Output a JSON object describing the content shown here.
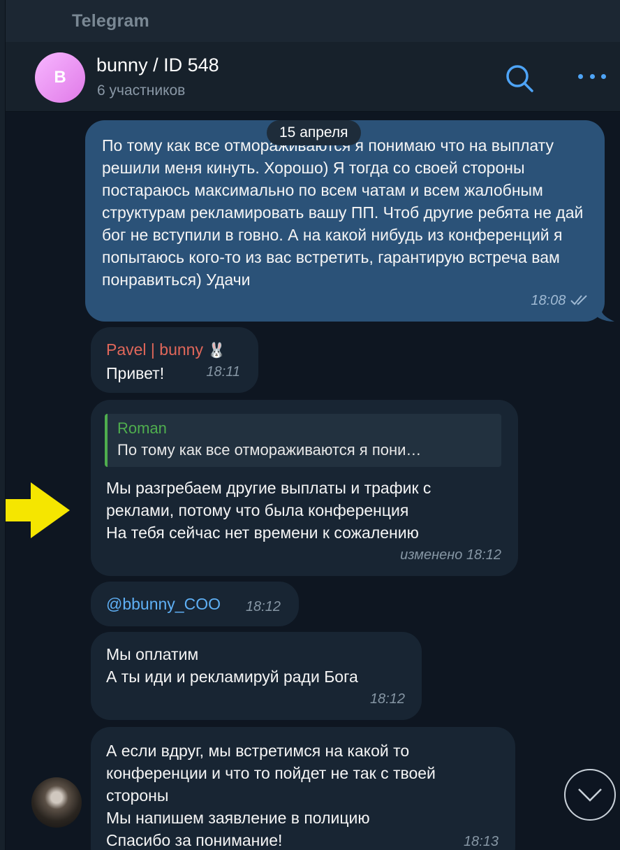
{
  "app": {
    "title": "Telegram"
  },
  "chat": {
    "avatar_letter": "B",
    "name": "bunny / ID 548",
    "subtitle": "6 участников"
  },
  "date_separator": "15 апреля",
  "messages": [
    {
      "direction": "out",
      "text": "По тому как все отмораживаются я понимаю что на выплату решили меня кинуть. Хорошо)   Я тогда со своей стороны постараюсь максимально по всем чатам и всем жалобным структурам рекламировать вашу ПП. Чтоб другие ребята не дай бог не вступили в говно. А на какой нибудь из конференций я попытаюсь кого-то из вас встретить, гарантирую встреча вам понравиться) Удачи",
      "time": "18:08"
    },
    {
      "direction": "in",
      "sender": "Pavel | bunny",
      "sender_emoji": "🐰",
      "text": "Привет!",
      "time": "18:11"
    },
    {
      "direction": "in",
      "reply_to_name": "Roman",
      "reply_to_text": "По тому как все отмораживаются я пони…",
      "lines": [
        "Мы разгребаем другие выплаты и трафик с",
        "реклами, потому что была конференция",
        "На тебя сейчас нет времени к сожалению"
      ],
      "time": "изменено 18:12"
    },
    {
      "direction": "in",
      "text": "@bbunny_COO",
      "time": "18:12"
    },
    {
      "direction": "in",
      "lines": [
        "Мы оплатим",
        "А ты иди и рекламируй ради Бога"
      ],
      "time": "18:12"
    },
    {
      "direction": "in",
      "lines": [
        "А если вдруг, мы встретимся на какой то",
        "конференции и что то пойдет не так с твоей",
        "стороны",
        "Мы напишем заявление в полицию",
        "Спасибо за понимание!"
      ],
      "time": "18:13"
    }
  ],
  "colors": {
    "background": "#0e1621",
    "outgoing_bubble": "#2b5278",
    "incoming_bubble": "#182533",
    "accent": "#4ea4f6",
    "sender_name": "#e0675a",
    "reply_name": "#4fae4e",
    "annotation_arrow": "#f5e600"
  },
  "icons": [
    "search-icon",
    "more-icon",
    "read-receipt-icon",
    "chevron-down-icon",
    "annotation-arrow"
  ]
}
